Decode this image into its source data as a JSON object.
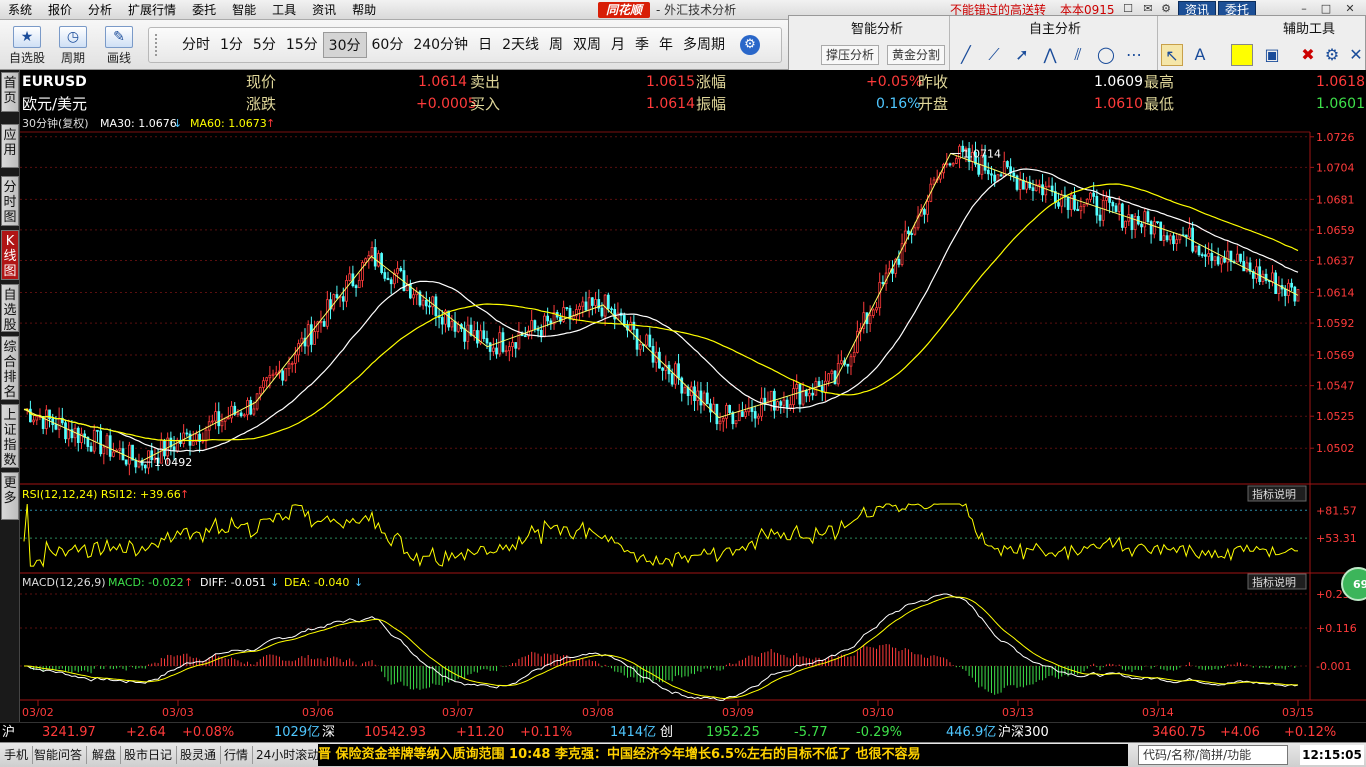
{
  "menubar": {
    "items": [
      "系统",
      "报价",
      "分析",
      "扩展行情",
      "委托",
      "智能",
      "工具",
      "资讯",
      "帮助"
    ],
    "logo": "同花顺",
    "app_title": "- 外汇技术分析",
    "promo": "不能错过的高送转",
    "version": "本本0915",
    "news_btn": "资讯",
    "trade_btn": "委托"
  },
  "toolbar": {
    "buttons": [
      "自选股",
      "周期",
      "画线"
    ],
    "periods": [
      "分时",
      "1分",
      "5分",
      "15分",
      "30分",
      "60分",
      "240分钟",
      "日",
      "2天线",
      "周",
      "双周",
      "月",
      "季",
      "年",
      "多周期"
    ],
    "active_period": "30分"
  },
  "analysis_panel": {
    "smart_title": "智能分析",
    "self_title": "自主分析",
    "aux_title": "辅助工具",
    "support_btn": "撑压分析",
    "golden_btn": "黄金分割"
  },
  "side_tabs": [
    "首页",
    "应用",
    "分时图",
    "K线图",
    "自选股",
    "综合排名",
    "上证指数",
    "更多"
  ],
  "quote": {
    "code": "EURUSD",
    "name": "欧元/美元",
    "now_label": "现价",
    "now": "1.0614",
    "sell_label": "卖出",
    "sell": "1.0615",
    "pct_label": "涨幅",
    "pct": "+0.05%",
    "prev_label": "昨收",
    "prev": "1.0609",
    "high_label": "最高",
    "high": "1.0618",
    "chg_label": "涨跌",
    "chg": "+0.0005",
    "buy_label": "买入",
    "buy": "1.0614",
    "amp_label": "振幅",
    "amp": "0.16%",
    "open_label": "开盘",
    "open": "1.0610",
    "low_label": "最低",
    "low": "1.0601"
  },
  "chart_data": {
    "type": "candlestick",
    "main_legend": {
      "prefix": "30分钟(复权)",
      "ma30": "MA30: 1.0676",
      "ma60": "MA60: 1.0673"
    },
    "y_ticks": [
      "1.0726",
      "1.0704",
      "1.0681",
      "1.0659",
      "1.0637",
      "1.0614",
      "1.0592",
      "1.0569",
      "1.0547",
      "1.0525",
      "1.0502"
    ],
    "ylim": [
      1.0482,
      1.0728
    ],
    "high_marker": "1.0714",
    "low_marker": "1.0492",
    "x_dates": [
      "03/02",
      "03/03",
      "03/06",
      "03/07",
      "03/08",
      "03/09",
      "03/10",
      "03/13",
      "03/14",
      "03/15"
    ],
    "zigzag": [
      1.053,
      1.0492,
      1.0535,
      1.064,
      1.0575,
      1.0605,
      1.0524,
      1.055,
      1.0714,
      1.0683,
      1.0655,
      1.0612
    ],
    "rsi": {
      "legend": "RSI(12,12,24) RSI12: +39.66",
      "ticks": [
        "+81.57",
        "+53.31"
      ],
      "btn": "指标说明"
    },
    "macd": {
      "legend_name": "MACD(12,26,9)",
      "macd": "MACD: -0.022",
      "diff": "DIFF: -0.051",
      "dea": "DEA: -0.040",
      "ticks": [
        "+0.231",
        "+0.116",
        "-0.001"
      ],
      "btn": "指标说明"
    },
    "badge": "69"
  },
  "status": {
    "sh_label": "沪",
    "sh_index": "3241.97",
    "sh_chg": "+2.64",
    "sh_pct": "+0.08%",
    "sh_amt": "1029亿",
    "sz_label": "深",
    "sz_index": "10542.93",
    "sz_chg": "+11.20",
    "sz_pct": "+0.11%",
    "sz_amt": "1414亿",
    "cy_label": "创",
    "cy_index": "1952.25",
    "cy_chg": "-5.77",
    "cy_pct": "-0.29%",
    "cy_amt": "446.9亿",
    "hs_label": "沪深300",
    "hs_index": "3460.75",
    "hs_chg": "+4.06",
    "hs_pct": "+0.12%"
  },
  "bottombar": {
    "items": [
      "手机",
      "智能问答",
      "解盘",
      "股市日记",
      "股灵通",
      "行情",
      "24小时滚动"
    ],
    "ticker": "晋 保险资金举牌等纳入质询范围        10:48 李克强：中国经济今年增长6.5%左右的目标不低了 也很不容易",
    "search": "代码/名称/简拼/功能",
    "clock": "12:15:05"
  }
}
